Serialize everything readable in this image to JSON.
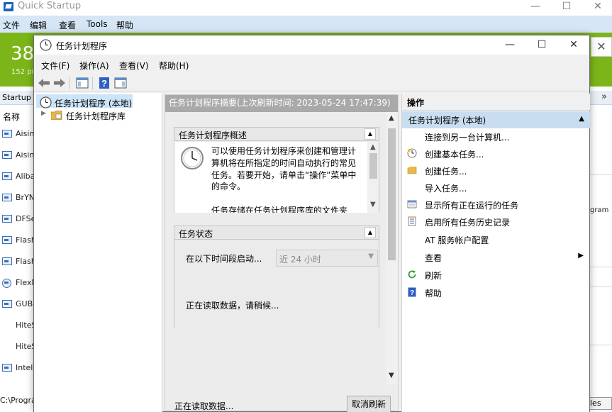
{
  "background_window": {
    "title": "Quick Startup",
    "controls": {
      "minimize": "—",
      "maximize": "☐",
      "close": "✕"
    },
    "menu": [
      "文件",
      "编辑",
      "查看",
      "Tools",
      "帮助"
    ],
    "banner": {
      "count": "38",
      "subtitle": "152 pr"
    },
    "banner_close": "✕",
    "tab_label": "Startup P",
    "tab_chevron": "»",
    "column_header": "名称",
    "rows": [
      {
        "name": "Aisinc"
      },
      {
        "name": "Aisinc"
      },
      {
        "name": "Aliba"
      },
      {
        "name": "BrYNS"
      },
      {
        "name": "DFSe"
      },
      {
        "name": "Flash"
      },
      {
        "name": "Flash"
      },
      {
        "name": "FlexN"
      },
      {
        "name": "GUBo"
      },
      {
        "name": "HiteS"
      },
      {
        "name": "HiteS"
      },
      {
        "name": "Intel"
      }
    ],
    "right_partial_text": "gram",
    "status_path": "C:\\Progra",
    "status_button": "les"
  },
  "scheduler_window": {
    "title": "任务计划程序",
    "controls": {
      "minimize": "—",
      "maximize": "☐",
      "close": "✕"
    },
    "menu": [
      "文件(F)",
      "操作(A)",
      "查看(V)",
      "帮助(H)"
    ],
    "tree": {
      "root": "任务计划程序 (本地)",
      "child": "任务计划程序库"
    },
    "summary_header": "任务计划程序摘要(上次刷新时间: 2023-05-24 17:47:39)",
    "overview": {
      "title": "任务计划程序概述",
      "paragraph1": "可以使用任务计划程序来创建和管理计算机将在所指定的时间自动执行的常见任务。若要开始，请单击“操作”菜单中的命令。",
      "paragraph2": "任务存储在任务计划程序库的文件夹"
    },
    "task_status": {
      "title": "任务状态",
      "period_label": "在以下时间段启动...",
      "period_value": "近 24 小时",
      "loading_text": "正在读取数据，请稍候..."
    },
    "footer": {
      "status": "正在读取数据...",
      "cancel_refresh": "取消刷新"
    },
    "actions": {
      "header": "操作",
      "group": "任务计划程序 (本地)",
      "items": [
        {
          "label": "连接到另一台计算机...",
          "icon": "none"
        },
        {
          "label": "创建基本任务...",
          "icon": "clock-create-icon"
        },
        {
          "label": "创建任务...",
          "icon": "folder-task-icon"
        },
        {
          "label": "导入任务...",
          "icon": "none"
        },
        {
          "label": "显示所有正在运行的任务",
          "icon": "running-tasks-icon"
        },
        {
          "label": "启用所有任务历史记录",
          "icon": "history-icon"
        },
        {
          "label": "AT 服务帐户配置",
          "icon": "none"
        },
        {
          "label": "查看",
          "icon": "none",
          "submenu": "▶"
        },
        {
          "label": "刷新",
          "icon": "refresh-icon"
        },
        {
          "label": "帮助",
          "icon": "help-icon"
        }
      ]
    }
  },
  "colors": {
    "banner_green": "#7cb51a",
    "menubar_blue": "#d6e6f6",
    "selection_blue": "#cce4f7",
    "actions_group_blue": "#c8ddf0",
    "summary_header_gray": "#a9a9a9"
  }
}
